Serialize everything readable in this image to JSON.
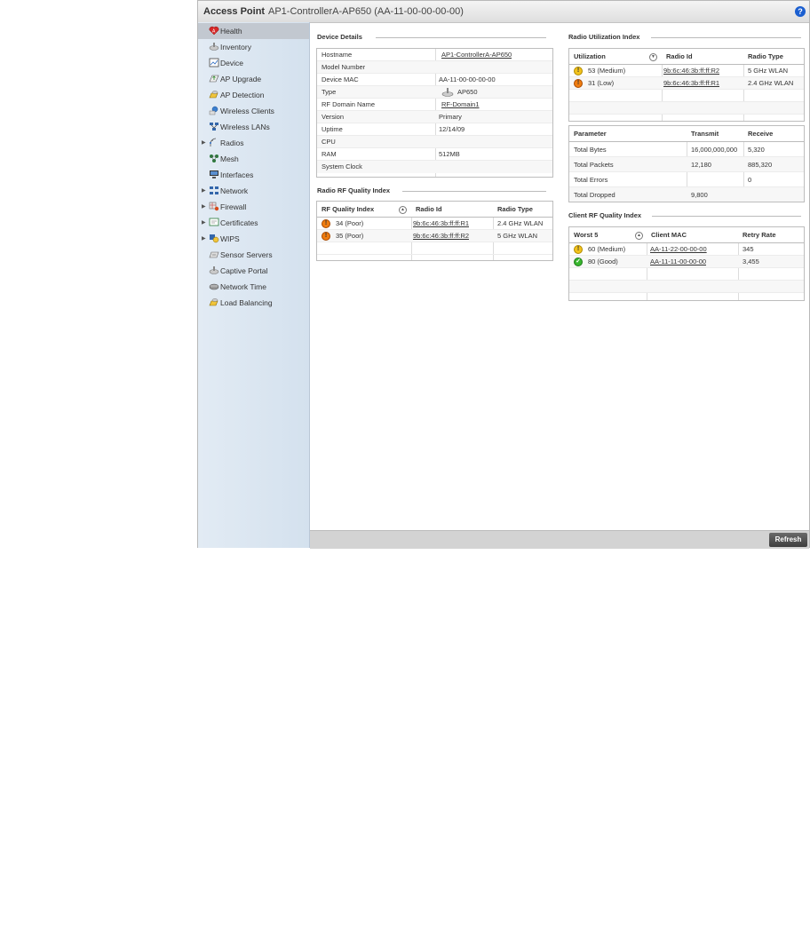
{
  "header": {
    "title": "Access Point",
    "subtitle": "AP1-ControllerA-AP650 (AA-11-00-00-00-00)",
    "help_label": "?"
  },
  "sidebar": {
    "items": [
      {
        "label": "Health",
        "icon": "health-icon",
        "active": true,
        "expandable": false
      },
      {
        "label": "Inventory",
        "icon": "inventory-icon",
        "expandable": false
      },
      {
        "label": "Device",
        "icon": "device-icon",
        "expandable": false
      },
      {
        "label": "AP Upgrade",
        "icon": "ap-upgrade-icon",
        "expandable": false
      },
      {
        "label": "AP Detection",
        "icon": "ap-detection-icon",
        "expandable": false
      },
      {
        "label": "Wireless Clients",
        "icon": "wireless-clients-icon",
        "expandable": false
      },
      {
        "label": "Wireless LANs",
        "icon": "wireless-lans-icon",
        "expandable": false
      },
      {
        "label": "Radios",
        "icon": "radios-icon",
        "expandable": true
      },
      {
        "label": "Mesh",
        "icon": "mesh-icon",
        "expandable": false
      },
      {
        "label": "Interfaces",
        "icon": "interfaces-icon",
        "expandable": false
      },
      {
        "label": "Network",
        "icon": "network-icon",
        "expandable": true
      },
      {
        "label": "Firewall",
        "icon": "firewall-icon",
        "expandable": true
      },
      {
        "label": "Certificates",
        "icon": "certificates-icon",
        "expandable": true
      },
      {
        "label": "WIPS",
        "icon": "wips-icon",
        "expandable": true
      },
      {
        "label": "Sensor Servers",
        "icon": "sensor-servers-icon",
        "expandable": false
      },
      {
        "label": "Captive Portal",
        "icon": "captive-portal-icon",
        "expandable": false
      },
      {
        "label": "Network Time",
        "icon": "network-time-icon",
        "expandable": false
      },
      {
        "label": "Load Balancing",
        "icon": "load-balancing-icon",
        "expandable": false
      }
    ]
  },
  "device_details": {
    "title": "Device Details",
    "rows": [
      {
        "label": "Hostname",
        "value": "AP1-ControllerA-AP650",
        "link": true
      },
      {
        "label": "Model Number",
        "value": ""
      },
      {
        "label": "Device MAC",
        "value": "AA-11-00-00-00-00"
      },
      {
        "label": "Type",
        "value": "AP650",
        "icon": "access-point-icon"
      },
      {
        "label": "RF Domain Name",
        "value": "RF-Domain1",
        "link": true
      },
      {
        "label": "Version",
        "value": "Primary"
      },
      {
        "label": "Uptime",
        "value": "12/14/09"
      },
      {
        "label": "CPU",
        "value": ""
      },
      {
        "label": "RAM",
        "value": "512MB"
      },
      {
        "label": "System Clock",
        "value": ""
      }
    ]
  },
  "radio_rf_quality": {
    "title": "Radio RF Quality Index",
    "headers": [
      "RF Quality Index",
      "Radio Id",
      "Radio Type"
    ],
    "rows": [
      {
        "status": "bad",
        "index": "34 (Poor)",
        "radio_id": "9b:6c:46:3b:ff:ff:R1",
        "radio_type": "2.4 GHz WLAN"
      },
      {
        "status": "bad",
        "index": "35 (Poor)",
        "radio_id": "9b:6c:46:3b:ff:ff:R2",
        "radio_type": "5 GHz WLAN"
      }
    ]
  },
  "radio_utilization": {
    "title": "Radio Utilization Index",
    "headers": [
      "Utilization",
      "Radio Id",
      "Radio Type"
    ],
    "rows": [
      {
        "status": "warn",
        "utilization": "53 (Medium)",
        "radio_id": "9b:6c:46:3b:ff:ff:R2",
        "radio_type": "5 GHz WLAN"
      },
      {
        "status": "bad",
        "utilization": "31 (Low)",
        "radio_id": "9b:6c:46:3b:ff:ff:R1",
        "radio_type": "2.4 GHz WLAN"
      }
    ]
  },
  "traffic": {
    "headers": [
      "Parameter",
      "Transmit",
      "Receive"
    ],
    "rows": [
      {
        "parameter": "Total Bytes",
        "transmit": "16,000,000,000",
        "receive": "5,320"
      },
      {
        "parameter": "Total Packets",
        "transmit": "12,180",
        "receive": "885,320"
      },
      {
        "parameter": "Total Errors",
        "transmit": "",
        "receive": "0"
      },
      {
        "parameter": "Total Dropped",
        "transmit": "9,800",
        "receive": ""
      }
    ]
  },
  "client_rf_quality": {
    "title": "Client RF Quality Index",
    "headers": [
      "Worst 5",
      "Client MAC",
      "Retry Rate"
    ],
    "rows": [
      {
        "status": "warn",
        "worst": "60 (Medium)",
        "mac": "AA-11-22-00-00-00",
        "retry": "345"
      },
      {
        "status": "good",
        "worst": "80 (Good)",
        "mac": "AA-11-11-00-00-00",
        "retry": "3,455"
      }
    ]
  },
  "footer": {
    "refresh_label": "Refresh"
  },
  "colors": {
    "sidebar_bg": "#d9e4ef",
    "status_warn": "#f2c21b",
    "status_bad": "#f07d10",
    "status_good": "#38b62e",
    "help": "#1b5fd0"
  }
}
